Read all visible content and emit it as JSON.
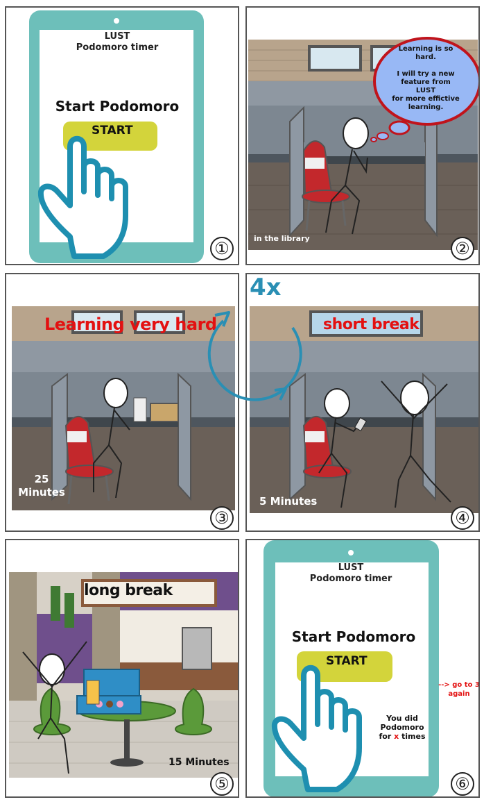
{
  "panels": [
    {
      "number": "①",
      "app_name": "LUST",
      "app_subtitle": "Podomoro timer",
      "heading": "Start Podomoro",
      "button_label": "START"
    },
    {
      "number": "②",
      "thought_bubble": [
        "Learning is so",
        "hard.",
        "",
        "I will try a new",
        "feature from",
        "LUST",
        "for more effictive",
        "learning."
      ],
      "location_caption": "in the library"
    },
    {
      "number": "③",
      "caption": "Learning very hard",
      "duration": [
        "25",
        "Minutes"
      ]
    },
    {
      "number": "④",
      "caption": "short break",
      "duration": "5 Minutes"
    },
    {
      "number": "⑤",
      "caption": "long break",
      "duration": "15 Minutes"
    },
    {
      "number": "⑥",
      "app_name": "LUST",
      "app_subtitle": "Podomoro timer",
      "heading": "Start Podomoro",
      "button_label": "START",
      "result_text": [
        "You did",
        "Podomoro"
      ],
      "result_prefix": "for ",
      "result_x": "x",
      "result_suffix": " times",
      "goto_note": [
        "--> go to 3",
        "again"
      ]
    }
  ],
  "cycle_label": "4x",
  "colors": {
    "tablet": "#6dbfba",
    "button": "#d3d43b",
    "hand": "#1e8fb0",
    "accent_red": "#e31111",
    "cycle_arrow": "#2a8fb4",
    "bubble": "#98b8f5",
    "bubble_border": "#c0141c"
  },
  "icons": [
    "hand-pointer-icon",
    "cycle-arrow-icon",
    "stick-figure",
    "chair",
    "cubicle"
  ]
}
